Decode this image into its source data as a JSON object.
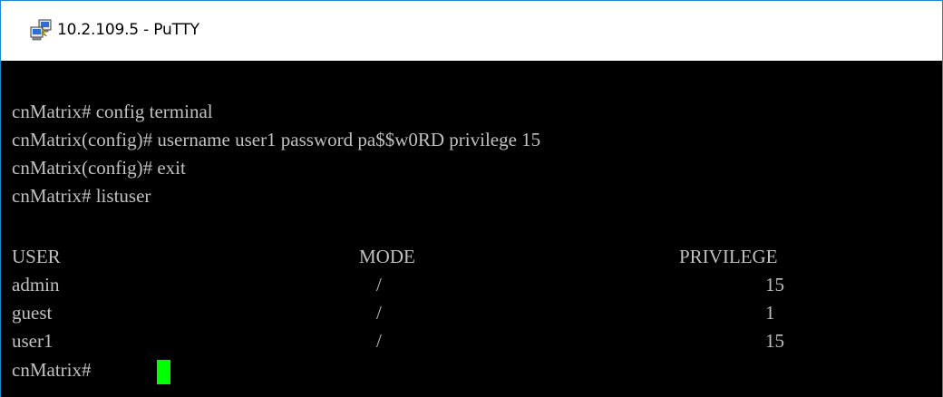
{
  "window": {
    "title": "10.2.109.5 - PuTTY",
    "icon": "putty-icon"
  },
  "terminal": {
    "background": "#000000",
    "text_color": "#c0c0c0",
    "cursor_color": "#00ff00",
    "commands": [
      "cnMatrix# config terminal",
      "cnMatrix(config)# username user1 password pa$$w0RD privilege 15",
      "cnMatrix(config)# exit",
      "cnMatrix# listuser"
    ],
    "table": {
      "headers": {
        "user": "USER",
        "mode": "MODE",
        "privilege": "PRIVILEGE"
      },
      "rows": [
        {
          "user": "admin",
          "mode": "/",
          "privilege": "15"
        },
        {
          "user": "guest",
          "mode": "/",
          "privilege": "1"
        },
        {
          "user": "user1",
          "mode": "/",
          "privilege": "15"
        }
      ]
    },
    "prompt": "cnMatrix# "
  }
}
